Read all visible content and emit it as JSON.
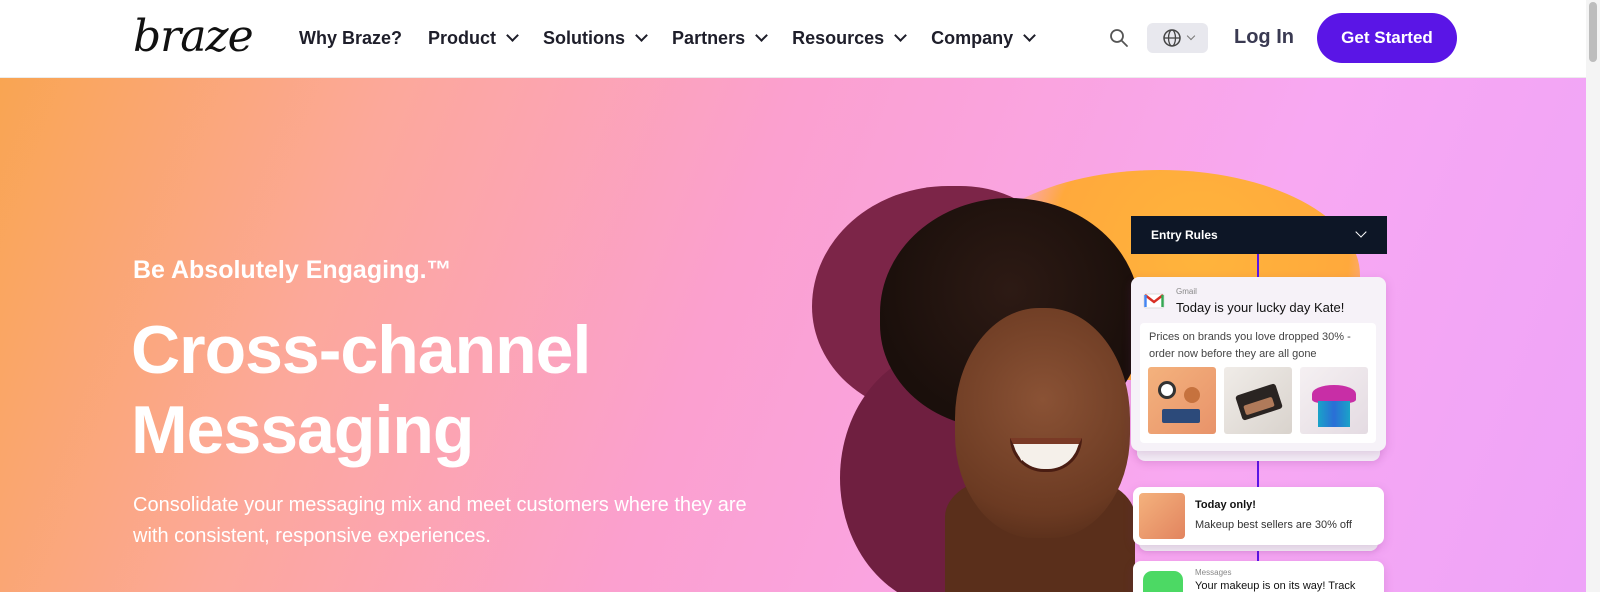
{
  "header": {
    "logo_text": "braze",
    "nav": [
      {
        "label": "Why Braze?",
        "has_dropdown": false
      },
      {
        "label": "Product",
        "has_dropdown": true
      },
      {
        "label": "Solutions",
        "has_dropdown": true
      },
      {
        "label": "Partners",
        "has_dropdown": true
      },
      {
        "label": "Resources",
        "has_dropdown": true
      },
      {
        "label": "Company",
        "has_dropdown": true
      }
    ],
    "search_icon": "search-icon",
    "language_icon": "globe-icon",
    "login_label": "Log In",
    "cta_label": "Get Started",
    "cta_color": "#5a15e6"
  },
  "hero": {
    "tagline": "Be Absolutely Engaging.™",
    "headline_line1": "Cross-channel",
    "headline_line2": "Messaging",
    "subtext": "Consolidate your messaging mix and meet customers where they are with consistent, responsive experiences."
  },
  "visual": {
    "entry_rules_label": "Entry Rules",
    "gmail_card": {
      "source": "Gmail",
      "subject": "Today is your lucky day Kate!",
      "body": "Prices on brands you love dropped 30% - order now before they are all gone"
    },
    "promo_card": {
      "title": "Today only!",
      "text": "Makeup best sellers are 30% off"
    },
    "messages_card": {
      "source": "Messages",
      "text": "Your makeup is on its way! Track"
    }
  }
}
